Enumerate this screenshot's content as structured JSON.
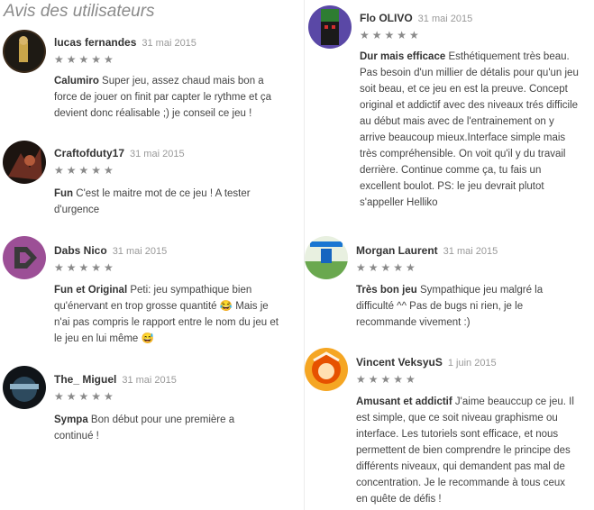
{
  "section_title": "Avis des utilisateurs",
  "star_glyph": "★★★★★",
  "left": [
    {
      "author": "lucas fernandes",
      "date": "31 mai 2015",
      "rating": 5,
      "title": "Calumiro",
      "text": "Super jeu, assez chaud mais bon a force de jouer on finit par capter le rythme et ça devient donc réalisable ;) je conseil ce jeu !"
    },
    {
      "author": "Craftofduty17",
      "date": "31 mai 2015",
      "rating": 5,
      "title": "Fun",
      "text": "C'est le maitre mot de ce jeu ! A tester d'urgence"
    },
    {
      "author": "Dabs Nico",
      "date": "31 mai 2015",
      "rating": 5,
      "title": "Fun et Original",
      "text": "Peti: jeu sympathique bien qu'énervant en trop grosse quantité 😂 Mais je n'ai pas compris le rapport entre le nom du jeu et le jeu en lui même 😅"
    },
    {
      "author": "The_ Miguel",
      "date": "31 mai 2015",
      "rating": 5,
      "title": "Sympa",
      "text": "Bon début pour une première a continué !"
    }
  ],
  "right": [
    {
      "author": "Flo OLIVO",
      "date": "31 mai 2015",
      "rating": 5,
      "title": "Dur mais efficace",
      "text": "Esthétiquement très beau. Pas besoin d'un millier de détalis pour qu'un jeu soit beau, et ce jeu en est la preuve. Concept original et addictif avec des niveaux trés difficile au début mais avec de l'entrainement on y arrive beaucoup mieux.Interface simple mais très compréhensible. On voit qu'il y du travail derrière. Continue comme ça, tu fais un excellent boulot. PS: le jeu devrait plutot s'appeller Helliko"
    },
    {
      "author": "Morgan Laurent",
      "date": "31 mai 2015",
      "rating": 5,
      "title": "Très bon jeu",
      "text": "Sympathique jeu malgré la difficulté ^^ Pas de bugs ni rien, je le recommande vivement :)"
    },
    {
      "author": "Vincent VeksyuS",
      "date": "1 juin 2015",
      "rating": 5,
      "title": "Amusant et addictif",
      "text": "J'aime beauccup ce jeu. Il est simple, que ce soit niveau graphisme ou interface. Les tutoriels sont efficace, et nous permettent de bien comprendre le principe des différents niveaux, qui demandent pas mal de concentration. Je le recommande à tous ceux en quête de défis !"
    }
  ]
}
